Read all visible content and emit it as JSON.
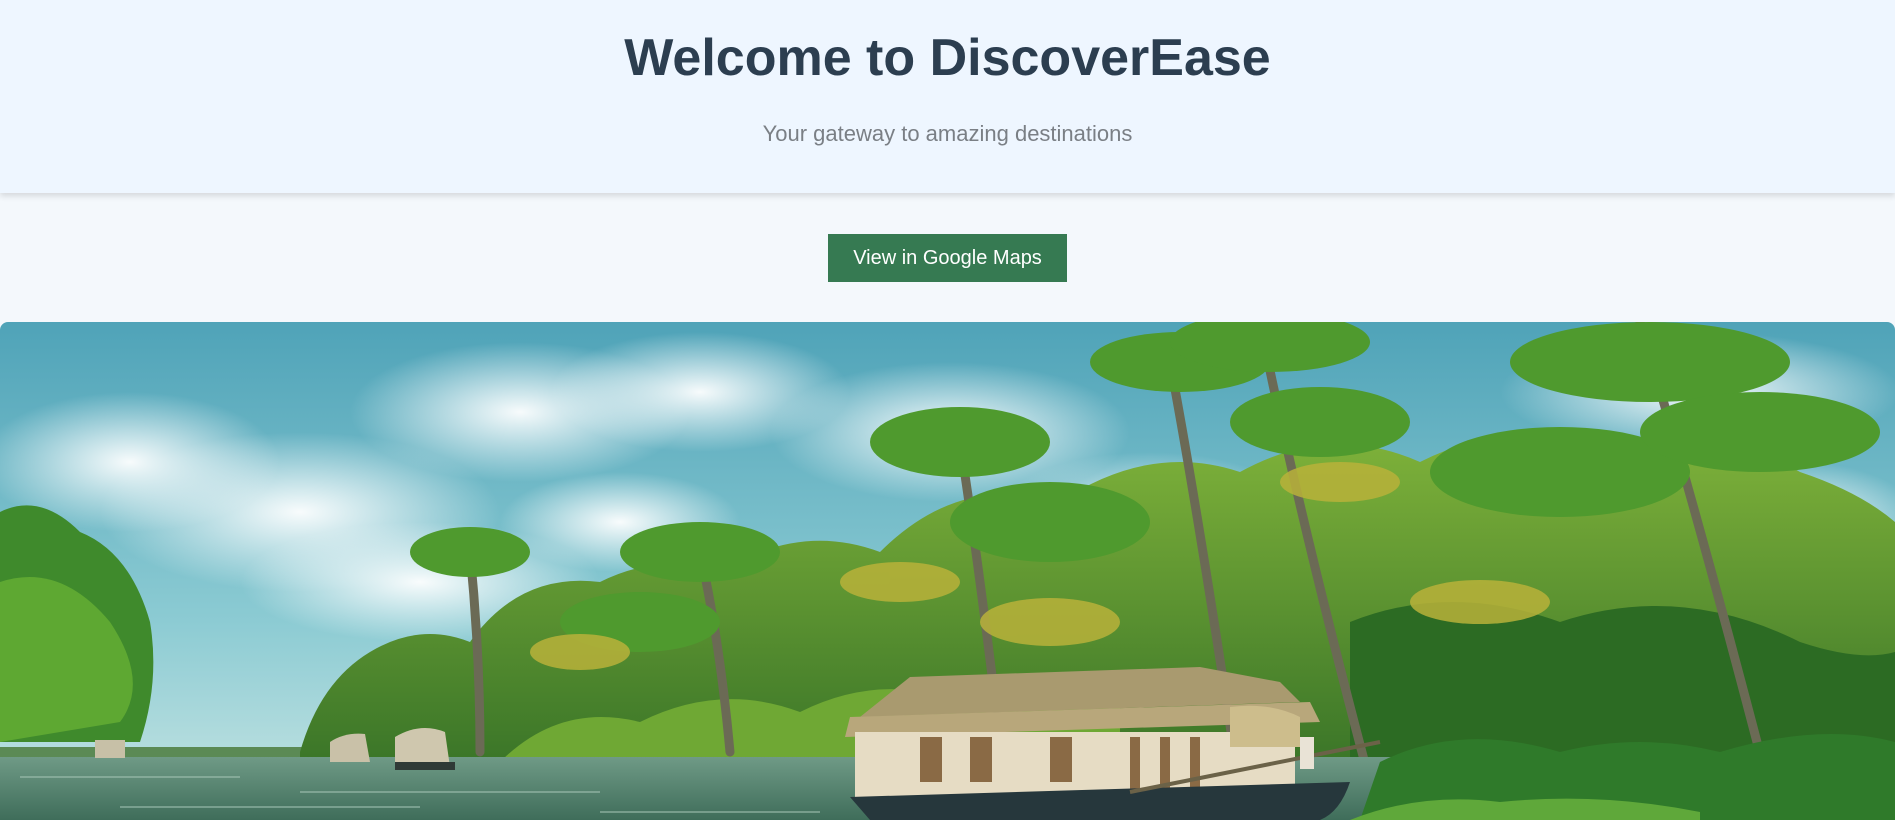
{
  "header": {
    "title": "Welcome to DiscoverEase",
    "subtitle": "Your gateway to amazing destinations"
  },
  "actions": {
    "maps_button_label": "View in Google Maps"
  },
  "hero": {
    "alt": "Houseboat on Kerala backwaters lined with coconut palms"
  },
  "colors": {
    "header_bg": "#eef6ff",
    "title": "#2c3e50",
    "subtitle": "#7a7f85",
    "button_bg": "#367a52",
    "page_bg": "#f4f8fc"
  }
}
